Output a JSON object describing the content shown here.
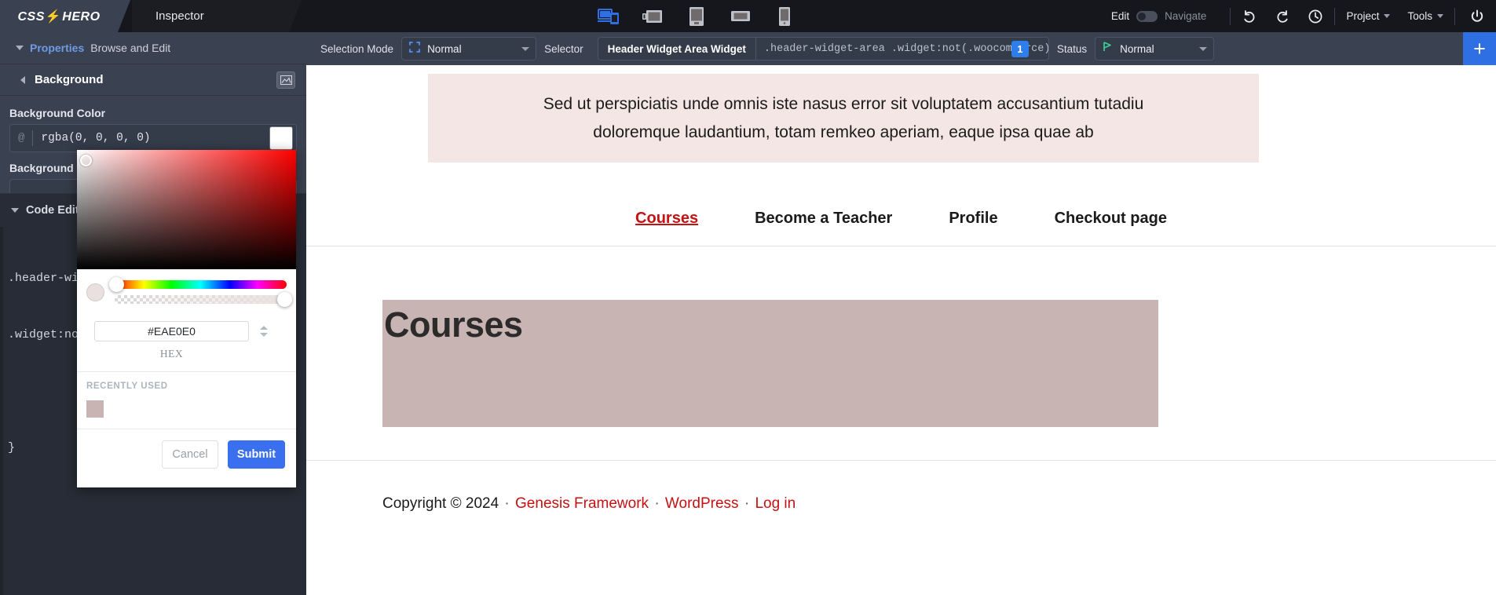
{
  "topbar": {
    "brand": "CSS",
    "brand2": "HERO",
    "tab_inspector": "Inspector",
    "devices": [
      {
        "name": "device-responsive",
        "label": "Responsive",
        "active": true
      },
      {
        "name": "device-desktop",
        "label": "Desktop",
        "active": false
      },
      {
        "name": "device-tablet-portrait",
        "label": "Tablet Portrait",
        "active": false
      },
      {
        "name": "device-tablet-landscape",
        "label": "Tablet Landscape",
        "active": false
      },
      {
        "name": "device-mobile",
        "label": "Mobile",
        "active": false
      }
    ],
    "edit_label": "Edit",
    "navigate_label": "Navigate",
    "undo_label": "Undo",
    "redo_label": "Redo",
    "history_label": "History",
    "project_label": "Project",
    "tools_label": "Tools",
    "power_label": "Exit"
  },
  "secondbar": {
    "selection_mode_label": "Selection Mode",
    "selection_mode_value": "Normal",
    "selector_label": "Selector",
    "selector_name": "Header Widget Area Widget",
    "selector_css": ".header-widget-area .widget:not(.woocommerce)",
    "selector_badge": "1",
    "status_label": "Status",
    "status_value": "Normal",
    "add_label": "+"
  },
  "sidebar": {
    "properties_label": "Properties",
    "properties_sub": "Browse and Edit",
    "section_title": "Background",
    "bg_image_icon": "image-icon",
    "bg_color_label": "Background Color",
    "bg_color_value": "rgba(0, 0, 0, 0)",
    "bg_color_swatch": "#ffffff",
    "bg_image_label": "Background Image",
    "code_editor_label": "Code Editor",
    "code_lines": [
      ".header-widget-area",
      ".widget:not(.woocommerce) {",
      "",
      "}"
    ]
  },
  "picker": {
    "hex_value": "#EAE0E0",
    "hex_format_label": "HEX",
    "recently_used_label": "RECENTLY USED",
    "recent_swatch": "#c8b4b2",
    "preview_color": "#EAE0E0",
    "cancel_label": "Cancel",
    "submit_label": "Submit"
  },
  "preview": {
    "header_widget_text": "Sed ut perspiciatis unde omnis iste nasus error sit voluptatem accusantium tutadiu doloremque laudantium, totam remkeo aperiam, eaque ipsa quae ab",
    "header_widget_line1": "Sed ut perspiciatis unde omnis iste nasus error sit voluptatem accusantium tutadiu",
    "header_widget_line2": "doloremque laudantium, totam remkeo aperiam, eaque ipsa quae ab",
    "header_widget_bg": "#f3e6e4",
    "nav": [
      {
        "label": "Courses",
        "active": true
      },
      {
        "label": "Become a Teacher",
        "active": false
      },
      {
        "label": "Profile",
        "active": false
      },
      {
        "label": "Checkout page",
        "active": false
      }
    ],
    "page_title": "Courses",
    "hero_bg": "#c8b4b2",
    "footer": {
      "copyright": "Copyright © 2024",
      "sep1": "·",
      "link1": "Genesis Framework",
      "sep2": "·",
      "link2": "WordPress",
      "sep3": "·",
      "link3": "Log in"
    }
  }
}
